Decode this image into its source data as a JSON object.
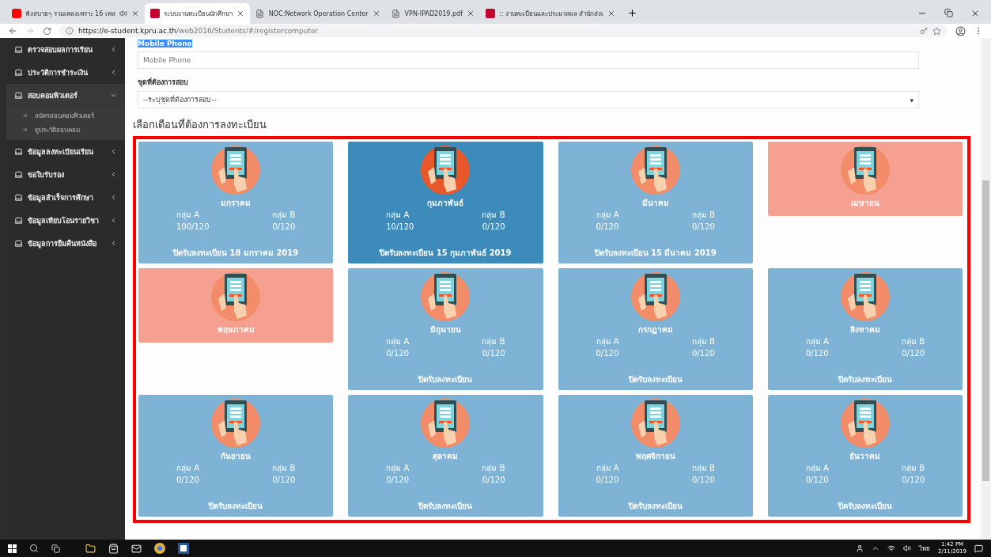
{
  "browser": {
    "tabs": [
      {
        "kind": "video",
        "title": "ฟังสบายๆ รวมเพลงเพราะ 16 เพล",
        "audio": true,
        "selected": false
      },
      {
        "kind": "app",
        "title": "ระบบงานทะเบียนนักศึกษา",
        "audio": false,
        "selected": true
      },
      {
        "kind": "doc",
        "title": "NOC:Network Operation Center",
        "audio": false,
        "selected": false
      },
      {
        "kind": "doc",
        "title": "VPN-IPAD2019.pdf",
        "audio": false,
        "selected": false
      },
      {
        "kind": "app",
        "title": ":: งานทะเบียนและประมวลผล สำนักส่งเ",
        "audio": false,
        "selected": false
      }
    ],
    "url_host": "https://e-student.kpru.ac.th",
    "url_path": "/web2016/Students/#/registercomputer"
  },
  "sidebar": {
    "items": [
      {
        "label": "ตรวจสอบผลการเรียน",
        "expanded": false
      },
      {
        "label": "ประวัติการชำระเงิน",
        "expanded": false
      },
      {
        "label": "สอบคอมพิวเตอร์",
        "expanded": true,
        "children": [
          {
            "label": "สมัครสอบคอมพิวเตอร์"
          },
          {
            "label": "ดูประวัติสอบคอม"
          }
        ]
      },
      {
        "label": "ข้อมูลลงทะเบียนเรียน",
        "expanded": false
      },
      {
        "label": "ขอใบรับรอง",
        "expanded": false
      },
      {
        "label": "ข้อมูลสำเร็จการศึกษา",
        "expanded": false
      },
      {
        "label": "ข้อมูลเทียบโอนรายวิชา",
        "expanded": false
      },
      {
        "label": "ข้อมูลการยืมคืนหนังสือ",
        "expanded": false
      }
    ]
  },
  "form": {
    "phone_label": "Mobile Phone",
    "phone_placeholder": "Mobile Phone",
    "set_label": "ชุดที่ต้องการสอบ",
    "set_value": "--ระบุชุดที่ต้องการสอบ--",
    "set_caret": "▼"
  },
  "section_title": "เลือกเดือนที่ต้องการลงทะเบียน",
  "months": [
    {
      "kind": "open",
      "selected": false,
      "name": "มกราคม",
      "group_a": "กลุ่ม A",
      "count_a": "100/120",
      "group_b": "กลุ่ม B",
      "count_b": "0/120",
      "status": "ปิดรับลงทะเบียน 18 มกราคม 2019"
    },
    {
      "kind": "open",
      "selected": true,
      "name": "กุมภาพันธ์",
      "group_a": "กลุ่ม A",
      "count_a": "10/120",
      "group_b": "กลุ่ม B",
      "count_b": "0/120",
      "status": "ปิดรับลงทะเบียน 15 กุมภาพันธ์ 2019"
    },
    {
      "kind": "open",
      "selected": false,
      "name": "มีนาคม",
      "group_a": "กลุ่ม A",
      "count_a": "0/120",
      "group_b": "กลุ่ม B",
      "count_b": "0/120",
      "status": "ปิดรับลงทะเบียน 15 มีนาคม 2019"
    },
    {
      "kind": "closed",
      "selected": false,
      "name": "เมษายน"
    },
    {
      "kind": "closed",
      "selected": false,
      "name": "พฤษภาคม"
    },
    {
      "kind": "open",
      "selected": false,
      "name": "มิถุนายน",
      "group_a": "กลุ่ม A",
      "count_a": "0/120",
      "group_b": "กลุ่ม B",
      "count_b": "0/120",
      "status": "ปิดรับลงทะเบียน"
    },
    {
      "kind": "open",
      "selected": false,
      "name": "กรกฎาคม",
      "group_a": "กลุ่ม A",
      "count_a": "0/120",
      "group_b": "กลุ่ม B",
      "count_b": "0/120",
      "status": "ปิดรับลงทะเบียน"
    },
    {
      "kind": "open",
      "selected": false,
      "name": "สิงหาคม",
      "group_a": "กลุ่ม A",
      "count_a": "0/120",
      "group_b": "กลุ่ม B",
      "count_b": "0/120",
      "status": "ปิดรับลงทะเบียน"
    },
    {
      "kind": "open",
      "selected": false,
      "name": "กันยายน",
      "group_a": "กลุ่ม A",
      "count_a": "0/120",
      "group_b": "กลุ่ม B",
      "count_b": "0/120",
      "status": "ปิดรับลงทะเบียน"
    },
    {
      "kind": "open",
      "selected": false,
      "name": "ตุลาคม",
      "group_a": "กลุ่ม A",
      "count_a": "0/120",
      "group_b": "กลุ่ม B",
      "count_b": "0/120",
      "status": "ปิดรับลงทะเบียน"
    },
    {
      "kind": "open",
      "selected": false,
      "name": "พฤศจิกายน",
      "group_a": "กลุ่ม A",
      "count_a": "0/120",
      "group_b": "กลุ่ม B",
      "count_b": "0/120",
      "status": "ปิดรับลงทะเบียน"
    },
    {
      "kind": "open",
      "selected": false,
      "name": "ธันวาคม",
      "group_a": "กลุ่ม A",
      "count_a": "0/120",
      "group_b": "กลุ่ม B",
      "count_b": "0/120",
      "status": "ปิดรับลงทะเบียน"
    }
  ],
  "taskbar": {
    "language": "ไทย",
    "time": "1:42 PM",
    "date": "2/11/2019"
  }
}
